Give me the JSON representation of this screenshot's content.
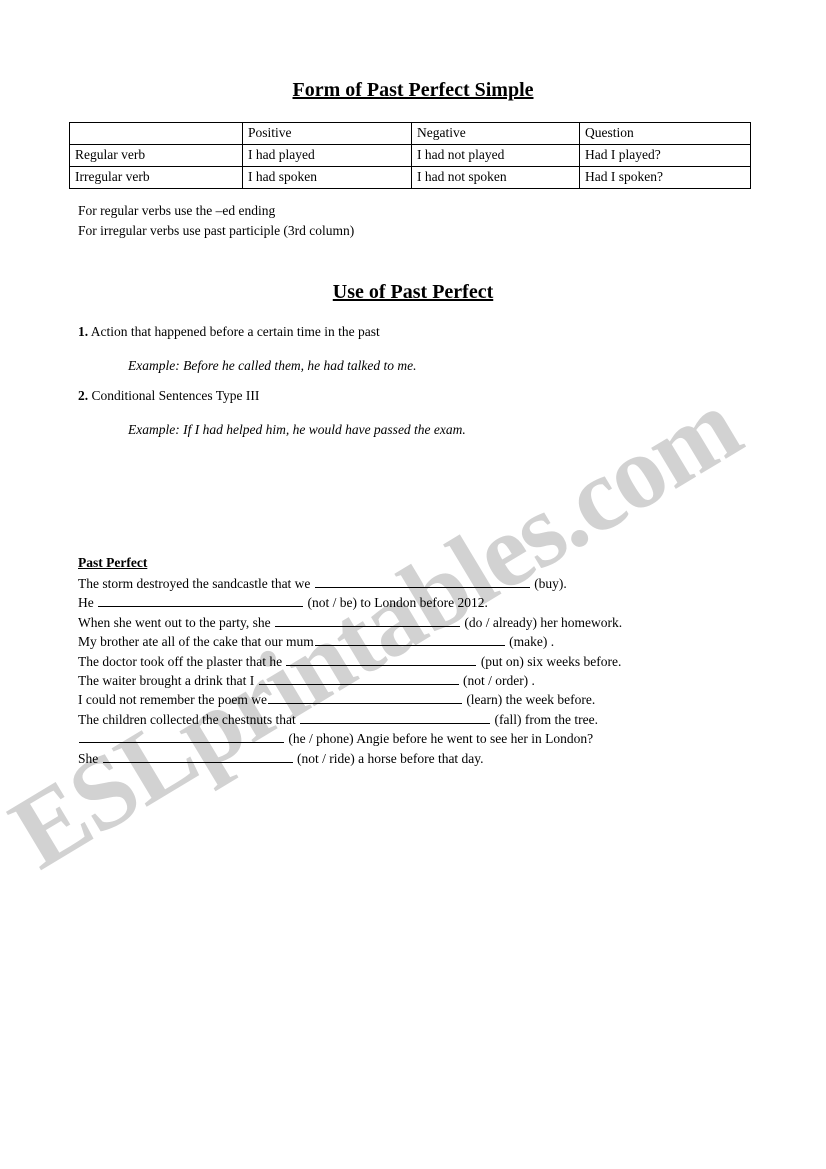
{
  "document": {
    "watermark": "ESLprintables.com",
    "watermark_color": "#d2d2d2",
    "page_background": "#ffffff",
    "text_color": "#000000"
  },
  "form_section": {
    "title": "Form of Past Perfect Simple",
    "table": {
      "headers": [
        "",
        "Positive",
        "Negative",
        "Question"
      ],
      "rows": [
        [
          "Regular verb",
          "I had played",
          "I had not played",
          "Had I played?"
        ],
        [
          "Irregular verb",
          "I had spoken",
          "I had not spoken",
          "Had I spoken?"
        ]
      ]
    },
    "notes": [
      "For regular verbs use the –ed ending",
      "For irregular verbs use past participle (3rd column)"
    ]
  },
  "use_section": {
    "title": "Use of Past Perfect",
    "items": [
      {
        "number": "1.",
        "text": "Action that happened before a certain time in the past",
        "example": "Example: Before he called them,  he had talked to me."
      },
      {
        "number": "2.",
        "text": "Conditional Sentences Type III",
        "example": "Example: If I had helped him, he would have passed the exam."
      }
    ]
  },
  "exercise": {
    "heading": "Past Perfect",
    "lines": [
      {
        "before": "The storm destroyed the sandcastle that we ",
        "blank_width": 215,
        "after": " (buy)."
      },
      {
        "before": "He ",
        "blank_width": 205,
        "after": " (not / be)  to London before 2012."
      },
      {
        "before": "When she went out to the party, she ",
        "blank_width": 185,
        "after": " (do / already)  her homework."
      },
      {
        "before": "My brother ate all of the cake that our mum",
        "blank_width": 190,
        "after": "  (make) ."
      },
      {
        "before": "The doctor took off the plaster that he ",
        "blank_width": 190,
        "after": " (put on)  six weeks before."
      },
      {
        "before": "The waiter brought a drink that I ",
        "blank_width": 200,
        "after": " (not / order) ."
      },
      {
        "before": "I could not remember the poem we",
        "blank_width": 194,
        "after": " (learn)  the week before."
      },
      {
        "before": "The children collected the chestnuts that ",
        "blank_width": 190,
        "after": " (fall)  from the tree."
      },
      {
        "before": "",
        "blank_width": 205,
        "after": " (he / phone)  Angie before he went to see her in London?"
      },
      {
        "before": "She ",
        "blank_width": 190,
        "after": " (not / ride)  a horse before that day."
      }
    ]
  }
}
